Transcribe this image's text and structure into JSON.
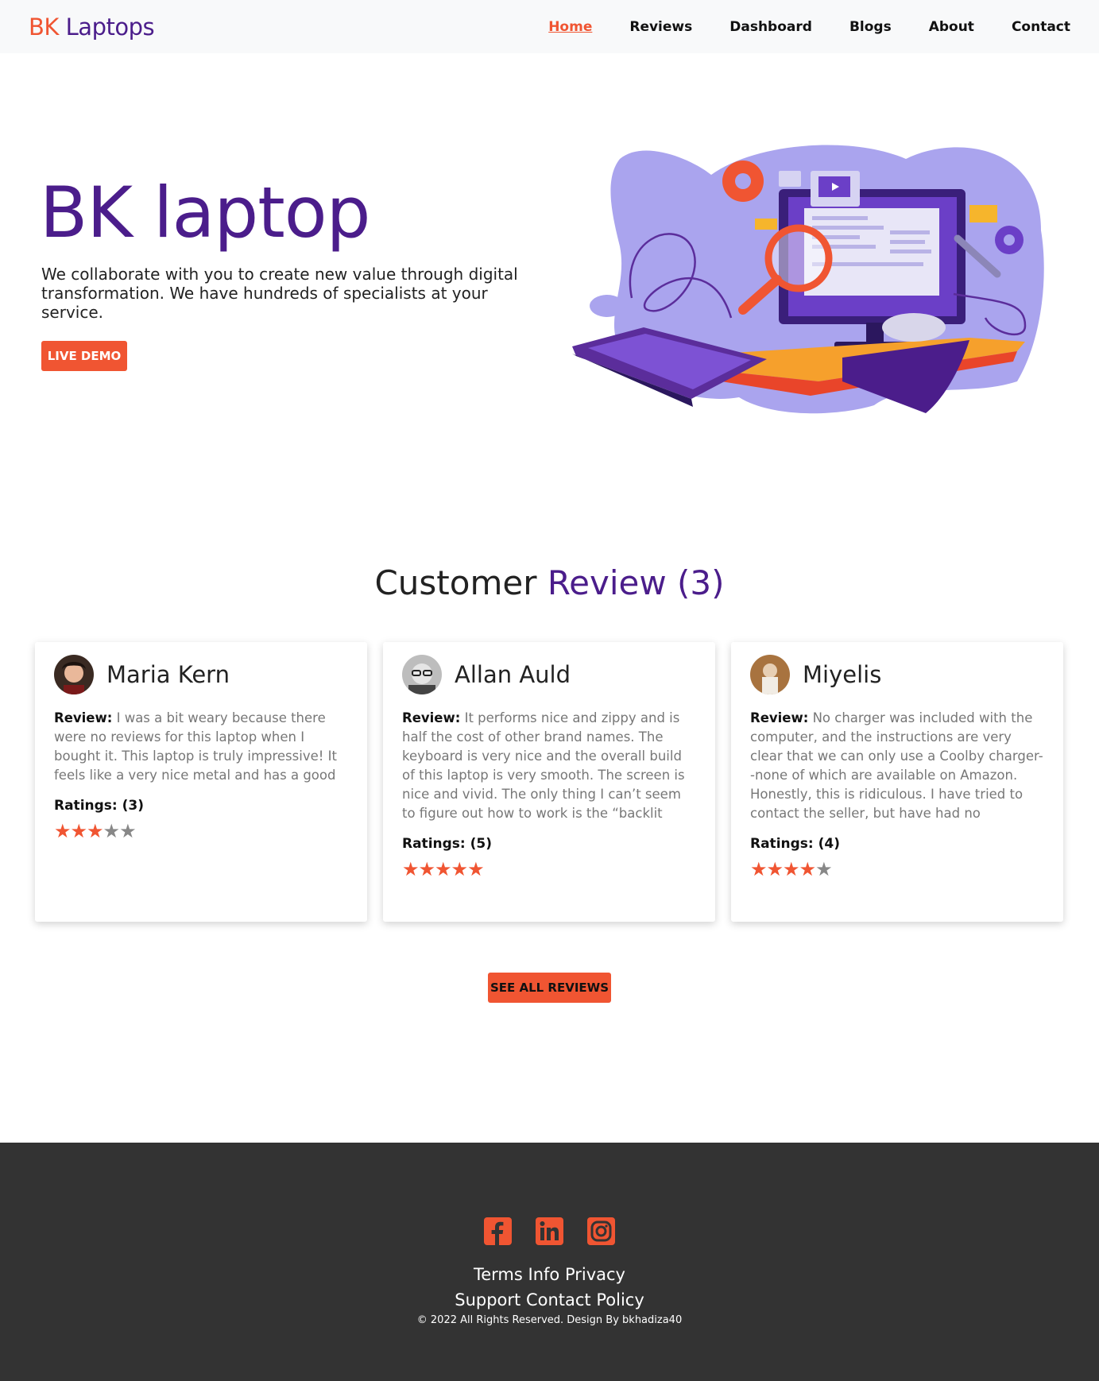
{
  "navbar": {
    "brand_part1": "BK",
    "brand_part2": "Laptops",
    "links": [
      "Home",
      "Reviews",
      "Dashboard",
      "Blogs",
      "About",
      "Contact"
    ],
    "active": "Home"
  },
  "hero": {
    "title": "BK laptop",
    "text": "We collaborate with you to create new value through digital transformation. We have hundreds of specialists at your service.",
    "button": "LIVE DEMO"
  },
  "reviews": {
    "title_part1": "Customer",
    "title_part2": "Review (3)",
    "review_label": "Review:",
    "items": [
      {
        "name": "Maria Kern",
        "text": "I was a bit weary because there were no reviews for this laptop when I bought it. This laptop is truly impressive! It feels like a very nice metal and has a good weight to it. Very good quality feel too it.",
        "rating_label": "Ratings: (3)",
        "rating": 3
      },
      {
        "name": "Allan Auld",
        "text": "It performs nice and zippy and is half the cost of other brand names. The keyboard is very nice and the overall build of this laptop is very smooth. The screen is nice and vivid. The only thing I can’t seem to figure out how to work is the “backlit keyboard” though. There is no button to turn it on and no setting in",
        "rating_label": "Ratings: (5)",
        "rating": 5
      },
      {
        "name": "Miyelis",
        "text": "No charger was included with the computer, and the instructions are very clear that we can only use a Coolby charger--none of which are available on Amazon. Honestly, this is ridiculous. I have tried to contact the seller, but have had no response. In their literature.",
        "rating_label": "Ratings: (4)",
        "rating": 4
      }
    ],
    "see_all": "SEE ALL REVIEWS",
    "max_stars": 5
  },
  "footer": {
    "socials": [
      "facebook-icon",
      "linkedin-icon",
      "instagram-icon"
    ],
    "links_line1": [
      "Terms",
      "Info",
      "Privacy"
    ],
    "links_line2": [
      "Support",
      "Contact",
      "Policy"
    ],
    "copyright": "© 2022 All Rights Reserved. Design By bkhadiza40"
  },
  "colors": {
    "accent": "#f05532",
    "brand_purple": "#4b1d8b",
    "footer_bg": "#333333",
    "navbar_bg": "#f8f9fa"
  }
}
